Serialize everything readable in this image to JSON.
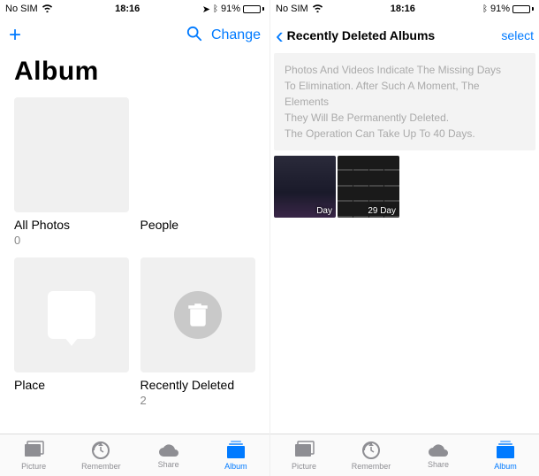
{
  "status": {
    "carrier": "No SIM",
    "time": "18:16",
    "battery_pct": "91%"
  },
  "left": {
    "nav": {
      "edit": "Change"
    },
    "title": "Album",
    "albums": {
      "all": {
        "label": "All Photos",
        "count": "0"
      },
      "people": {
        "label": "People"
      },
      "places": {
        "label": "Place"
      },
      "deleted": {
        "label": "Recently Deleted",
        "count": "2"
      }
    }
  },
  "right": {
    "nav": {
      "back": "Recently Deleted Albums",
      "select": "select"
    },
    "banner": {
      "l1": "Photos And Videos Indicate The Missing Days",
      "l2": "To Elimination. After Such A Moment, The Elements",
      "l3": "They Will Be Permanently Deleted.",
      "l4": "The Operation Can Take Up To 40 Days."
    },
    "thumbs": {
      "d1": "Day",
      "d2": "29 Day"
    }
  },
  "tabs": {
    "photos": "Picture",
    "memories": "Remember",
    "shared": "Share",
    "albums": "Album"
  }
}
